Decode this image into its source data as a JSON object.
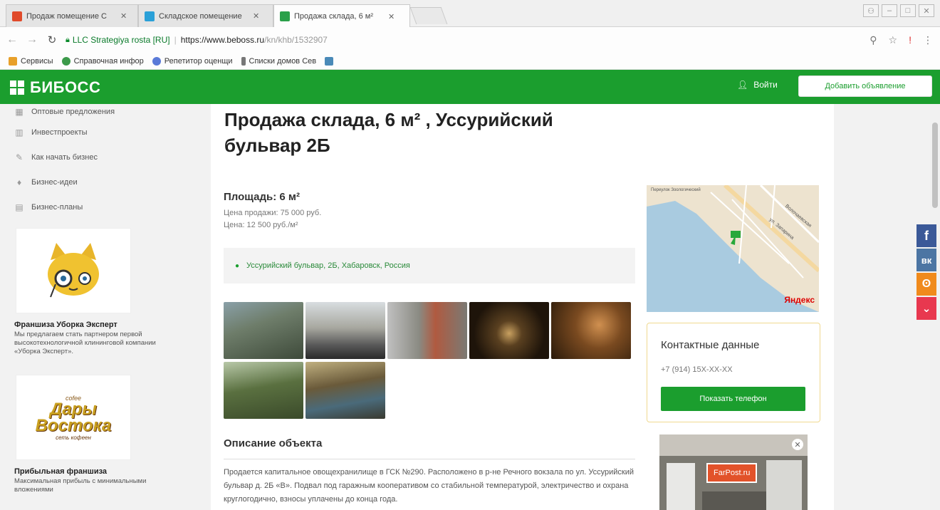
{
  "browser": {
    "tabs": [
      {
        "title": "Продаж помещение С",
        "color": "#e04a2a"
      },
      {
        "title": "Складское помещение",
        "color": "#2aa0d8"
      },
      {
        "title": "Продажа склада, 6 м²",
        "color": "#2aa04a"
      }
    ],
    "url": {
      "org": "LLC Strategiya rosta [RU]",
      "host": "https://www.beboss.ru",
      "path": "/kn/khb/1532907"
    },
    "bookmarks": [
      {
        "label": "Сервисы",
        "color": "#e8a02a"
      },
      {
        "label": "Справочная инфор",
        "color": "#3c9a4a"
      },
      {
        "label": "Репетитор оценщи",
        "color": "#5a7ad8"
      },
      {
        "label": "Списки домов Сев",
        "color": "#777"
      }
    ]
  },
  "header": {
    "logo": "БИБОСС",
    "login": "Войти",
    "add_button": "Добавить объявление"
  },
  "sidebar": {
    "items": [
      {
        "label": "Оптовые предложения",
        "icon": "boxes-icon"
      },
      {
        "label": "Инвестпроекты",
        "icon": "building-icon"
      },
      {
        "label": "Как начать бизнес",
        "icon": "pencil-icon"
      },
      {
        "label": "Бизнес-идеи",
        "icon": "lightbulb-icon"
      },
      {
        "label": "Бизнес-планы",
        "icon": "document-icon"
      }
    ],
    "ads": [
      {
        "title": "Франшиза Уборка Эксперт",
        "text": "Мы предлагаем стать партнером первой высокотехнологичной клининговой компании «Уборка Эксперт»."
      },
      {
        "title": "Прибыльная франшиза",
        "text": "Максимальная прибыль с минимальными вложениями"
      }
    ],
    "ad2_logo": {
      "line1": "Дары",
      "line2": "Востока",
      "tag": "cofee",
      "sub": "сеть кофеен"
    }
  },
  "listing": {
    "title": "Продажа склада, 6 м² , Уссурийский бульвар 2Б",
    "area": "Площадь: 6 м²",
    "price": "Цена продажи: 75 000 руб.",
    "price_per_m2": "Цена: 12 500 руб./м²",
    "address": "Уссурийский бульвар, 2Б, Хабаровск, Россия",
    "description_heading": "Описание объекта",
    "description": "Продается капитальное овощехранилище в ГСК №290. Расположено в р-не Речного вокзала по ул. Уссурийский бульвар д. 2Б «В». Подвал под гаражным кооперативом со стабильной температурой, электричество и охрана круглогодично, взносы уплачены до конца года."
  },
  "map": {
    "label": "Переулок Зоологический",
    "street1": "ул. Запарина",
    "street2": "Волочаевская",
    "brand": "Яндекс"
  },
  "contact": {
    "title": "Контактные данные",
    "phone": "+7 (914) 15X-XX-XX",
    "button": "Показать телефон"
  },
  "ad_right": {
    "label": "FarPost.ru"
  },
  "social": [
    "f",
    "вк",
    "ок",
    "pocket"
  ]
}
